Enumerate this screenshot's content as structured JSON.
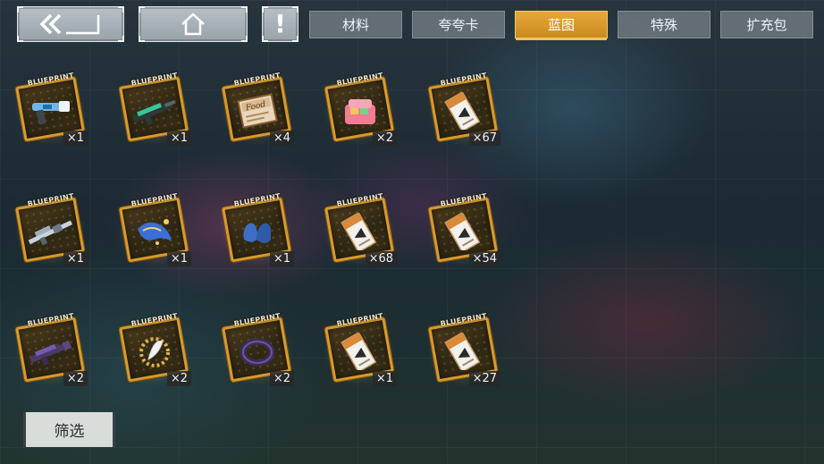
{
  "topbar": {
    "back_icon": "double-chevron-left-icon",
    "home_icon": "home-icon",
    "info_label": "!"
  },
  "tabs": [
    {
      "label": "材料",
      "active": false
    },
    {
      "label": "夸夸卡",
      "active": false
    },
    {
      "label": "蓝图",
      "active": true
    },
    {
      "label": "特殊",
      "active": false
    },
    {
      "label": "扩充包",
      "active": false
    }
  ],
  "blueprint_label": "BLUEPRINT",
  "items": [
    {
      "icon": "blaster-pistol-icon",
      "count": "×1"
    },
    {
      "icon": "green-rifle-icon",
      "count": "×1"
    },
    {
      "icon": "food-book-icon",
      "count": "×4"
    },
    {
      "icon": "pink-lunchbox-icon",
      "count": "×2"
    },
    {
      "icon": "ticket-icon",
      "count": "×67"
    },
    {
      "icon": "sniper-rifle-icon",
      "count": "×1"
    },
    {
      "icon": "blue-scarf-icon",
      "count": "×1"
    },
    {
      "icon": "blue-gloves-icon",
      "count": "×1"
    },
    {
      "icon": "ticket-icon",
      "count": "×68"
    },
    {
      "icon": "ticket-icon",
      "count": "×54"
    },
    {
      "icon": "purple-rifle-icon",
      "count": "×2"
    },
    {
      "icon": "feather-badge-icon",
      "count": "×2"
    },
    {
      "icon": "purple-ring-icon",
      "count": "×2"
    },
    {
      "icon": "ticket-icon",
      "count": "×1"
    },
    {
      "icon": "ticket-icon",
      "count": "×27"
    }
  ],
  "filter": {
    "label": "筛选"
  }
}
